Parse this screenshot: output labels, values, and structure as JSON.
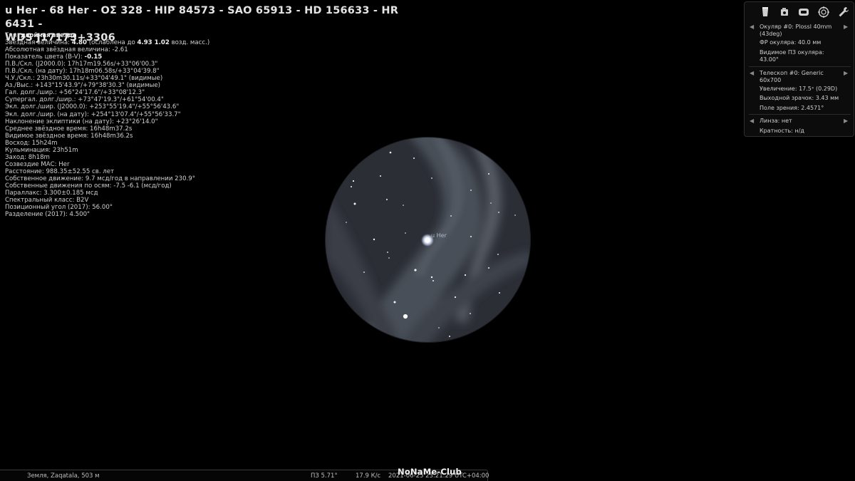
{
  "info": {
    "title_line1": "u Her - 68 Her - ΟΣ 328 - HIP 84573 - SAO 65913 - HD 156633 - HR 6431 -",
    "title_line2": "WDS J17173+3306",
    "lines": [
      {
        "label": "Тип: ",
        "bold": "двойная звезда",
        "rest": ""
      },
      {
        "label": "Звёздная величина: ",
        "bold": "4.80",
        "rest": " (ослаблена до ",
        "bold2": "4.93 1.02",
        "rest2": " возд. масс.)"
      },
      {
        "label": "Абсолютная звёздная величина: -2.61"
      },
      {
        "label": "Показатель цвета (B-V): ",
        "bold": "-0.15",
        "rest": ""
      },
      {
        "label": "П.В./Скл. (J2000.0):  17h17m19.56s/+33°06'00.3\""
      },
      {
        "label": "П.В./Скл. (на дату):  17h18m06.58s/+33°04'39.8\""
      },
      {
        "label": "Ч.У./Скл.: 23h30m30.11s/+33°04'49.1\" (видимые)"
      },
      {
        "label": "Аз./Выс.: +143°15'43.9\"/+79°38'30.3\" (видимые)"
      },
      {
        "label": "Гал. долг./шир.: +56°24'17.6\"/+33°08'12.3\""
      },
      {
        "label": "Супергал. долг./шир.: +73°47'19.3\"/+61°54'00.4\""
      },
      {
        "label": "Экл. долг./шир. (J2000.0):  +253°55'19.4\"/+55°56'43.6\""
      },
      {
        "label": "Экл. долг./шир. (на дату):  +254°13'07.4\"/+55°56'33.7\""
      },
      {
        "label": "Наклонение эклиптики (на дату): +23°26'14.0\""
      },
      {
        "label": "Среднее звёздное время: 16h48m37.2s"
      },
      {
        "label": "Видимое звёздное время: 16h48m36.2s"
      },
      {
        "label": "Восход: 15h24m"
      },
      {
        "label": "Кульминация: 23h51m"
      },
      {
        "label": "Заход: 8h18m"
      },
      {
        "label": "Созвездие МАС: Her"
      },
      {
        "label": "Расстояние: 988.35±52.55 св. лет"
      },
      {
        "label": "Собственное движение: 9.7 мсд/год в направлении 230.9°"
      },
      {
        "label": "Собственные движения по осям: -7.5 -6.1 (мсд/год)"
      },
      {
        "label": "Параллакс: 3.300±0.185 мсд"
      },
      {
        "label": "Спектральный класс: B2V"
      },
      {
        "label": "Позиционный угол (2017): 56.00°"
      },
      {
        "label": "Разделение (2017): 4.500\""
      }
    ]
  },
  "fov": {
    "star_label": "u Her",
    "background_color": "#2b2e35",
    "milkyway_color": "#4d525c"
  },
  "ocular_panel": {
    "tools": [
      "ocular-icon",
      "sensor-icon",
      "telescope-icon",
      "crosshair-icon",
      "wrench-icon"
    ],
    "ocular_name": "Окуляр #0: Plossl 40mm (43deg)",
    "ocular_fl": "ФР окуляра: 40.0 мм",
    "ocular_afov": "Видимое ПЗ окуляра: 43.00°",
    "telescope_name": "Телескоп #0: Generic 60x700",
    "magnification": "Увеличение: 17.5ˣ (0.29D)",
    "exit_pupil": "Выходной зрачок: 3.43 мм",
    "fov": "Поле зрения: 2.4571°",
    "lens": "Линза: нет",
    "multiplicity": "Кратность: н/д"
  },
  "statusbar": {
    "location": "Земля, Zaqatala, 503 м",
    "fov": "ПЗ 5.71°",
    "fps": "17.9 К/с",
    "datetime": "2021-06-25 23:21:29 UTC+04:00"
  },
  "watermark": "NoNaMe-Club",
  "colors": {
    "background": "#000000",
    "text": "#d6d6d6",
    "panel": "#0c0c0c"
  }
}
